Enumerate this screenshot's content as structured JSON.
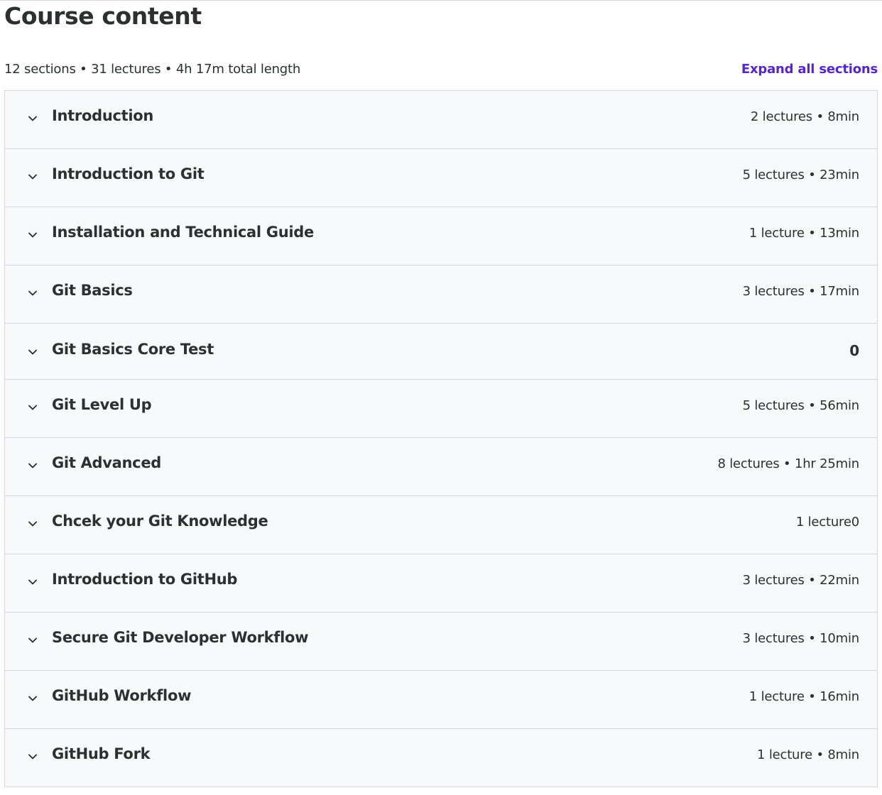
{
  "page": {
    "title": "Course content",
    "summary": "12 sections • 31 lectures • 4h 17m total length",
    "expand_all_label": "Expand all sections"
  },
  "sections": [
    {
      "title": "Introduction",
      "meta": "2 lectures • 8min"
    },
    {
      "title": "Introduction to Git",
      "meta": "5 lectures • 23min"
    },
    {
      "title": "Installation and Technical Guide",
      "meta": "1 lecture • 13min"
    },
    {
      "title": "Git Basics",
      "meta": "3 lectures • 17min"
    },
    {
      "title": "Git Basics Core Test",
      "meta": "0"
    },
    {
      "title": "Git Level Up",
      "meta": "5 lectures • 56min"
    },
    {
      "title": "Git Advanced",
      "meta": "8 lectures • 1hr 25min"
    },
    {
      "title": "Chcek your Git Knowledge",
      "meta": "1 lecture0"
    },
    {
      "title": "Introduction to GitHub",
      "meta": "3 lectures • 22min"
    },
    {
      "title": "Secure Git Developer Workflow",
      "meta": "3 lectures • 10min"
    },
    {
      "title": "GitHub Workflow",
      "meta": "1 lecture • 16min"
    },
    {
      "title": "GitHub Fork",
      "meta": "1 lecture • 8min"
    }
  ],
  "icons": {
    "section_toggle": "chevron-down-icon"
  },
  "colors": {
    "accent": "#5624d0",
    "text": "#2d2f31",
    "section_background": "#f7f9fa",
    "border": "#d1d7dc"
  }
}
